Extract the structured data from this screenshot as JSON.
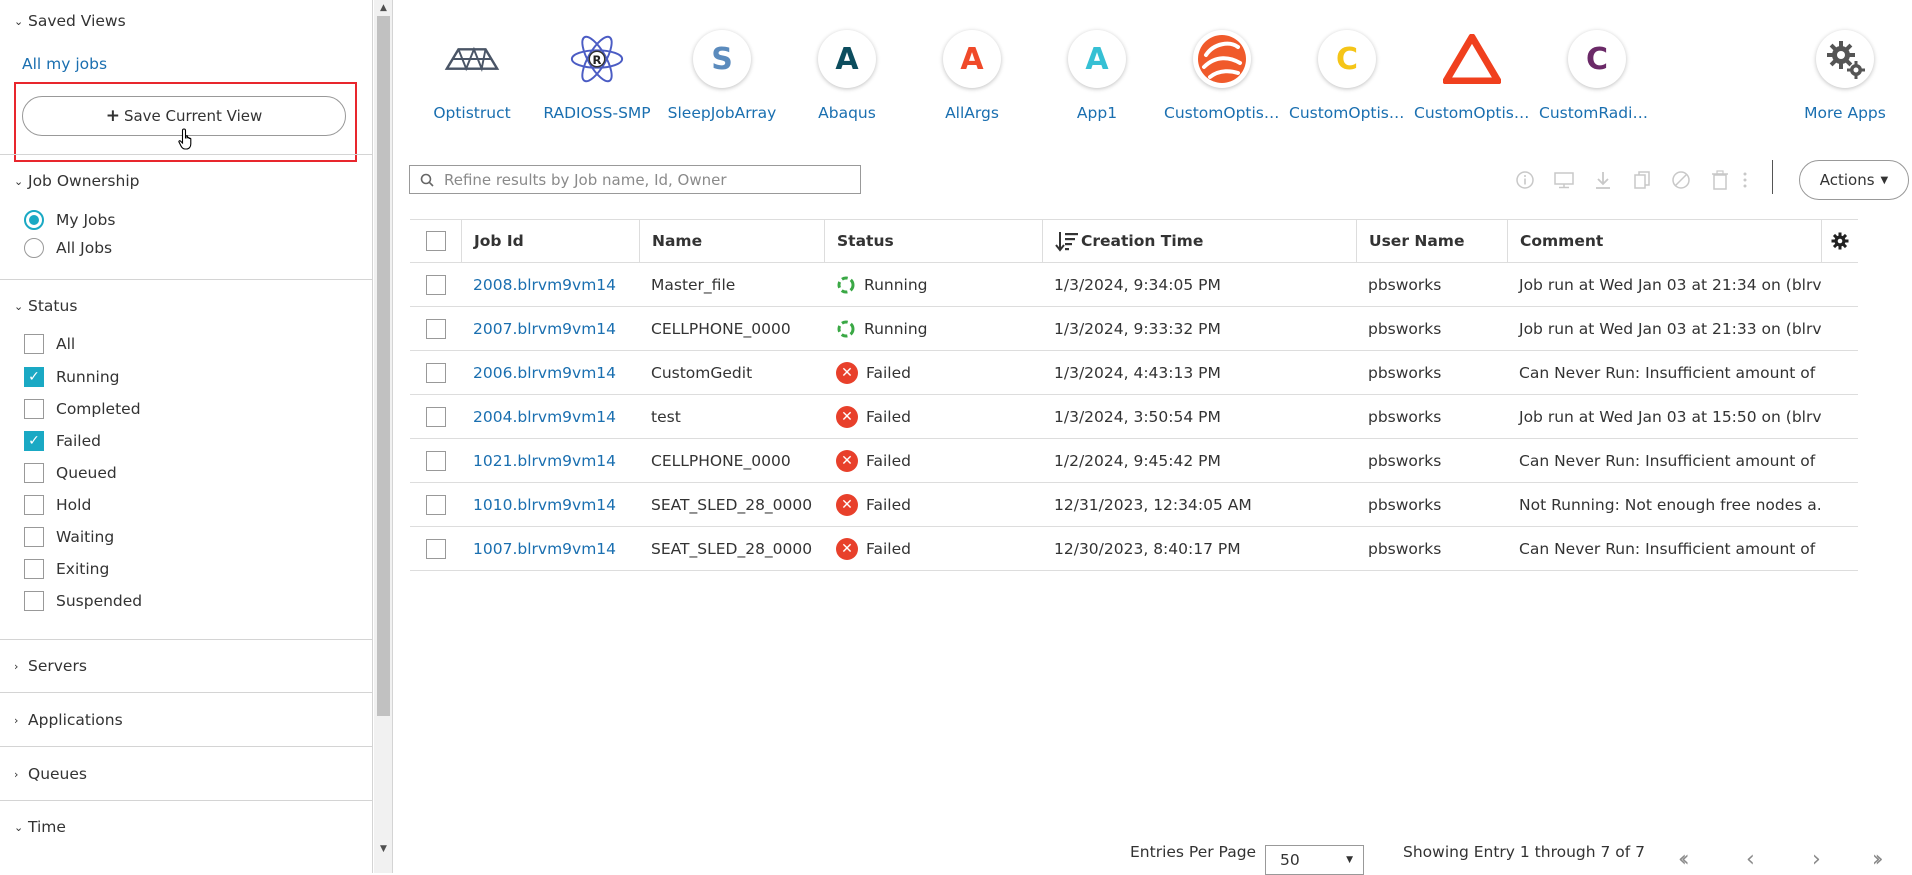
{
  "sidebar": {
    "saved_views": {
      "header": "Saved Views",
      "all_my_jobs": "All my jobs",
      "save_button": "Save Current View"
    },
    "ownership": {
      "header": "Job Ownership",
      "options": [
        {
          "label": "My Jobs",
          "selected": true
        },
        {
          "label": "All Jobs",
          "selected": false
        }
      ]
    },
    "status": {
      "header": "Status",
      "options": [
        {
          "label": "All",
          "checked": false
        },
        {
          "label": "Running",
          "checked": true
        },
        {
          "label": "Completed",
          "checked": false
        },
        {
          "label": "Failed",
          "checked": true
        },
        {
          "label": "Queued",
          "checked": false
        },
        {
          "label": "Hold",
          "checked": false
        },
        {
          "label": "Waiting",
          "checked": false
        },
        {
          "label": "Exiting",
          "checked": false
        },
        {
          "label": "Suspended",
          "checked": false
        }
      ]
    },
    "servers": "Servers",
    "applications": "Applications",
    "queues": "Queues",
    "time": "Time"
  },
  "apps": [
    {
      "label": "Optistruct",
      "icon": "optistruct-icon"
    },
    {
      "label": "RADIOSS-SMP",
      "icon": "radioss-atom-icon"
    },
    {
      "label": "SleepJobArray",
      "icon": "letter-s-icon",
      "letter": "S",
      "color": "#5b8bbd"
    },
    {
      "label": "Abaqus",
      "icon": "letter-a-icon",
      "letter": "A",
      "color": "#0c4d5e"
    },
    {
      "label": "AllArgs",
      "icon": "letter-a-icon",
      "letter": "A",
      "color": "#f04a2a"
    },
    {
      "label": "App1",
      "icon": "letter-a-icon",
      "letter": "A",
      "color": "#36c0d4"
    },
    {
      "label": "CustomOptist...",
      "icon": "custom-optistruct-swirl-icon"
    },
    {
      "label": "CustomOptist...",
      "icon": "letter-c-icon",
      "letter": "C",
      "color": "#f5c518"
    },
    {
      "label": "CustomOptist...",
      "icon": "altair-triangle-icon"
    },
    {
      "label": "CustomRadioss",
      "icon": "letter-c-icon",
      "letter": "C",
      "color": "#6b2a68"
    }
  ],
  "more_apps": "More Apps",
  "search": {
    "placeholder": "Refine results by Job name, Id, Owner",
    "value": ""
  },
  "actions_label": "Actions",
  "table": {
    "columns": [
      "Job Id",
      "Name",
      "Status",
      "Creation Time",
      "User Name",
      "Comment"
    ],
    "rows": [
      {
        "id": "2008.blrvm9vm14",
        "name": "Master_file",
        "status": "Running",
        "created": "1/3/2024, 9:34:05 PM",
        "user": "pbsworks",
        "comment": "Job run at Wed Jan 03 at 21:34 on (blrv..."
      },
      {
        "id": "2007.blrvm9vm14",
        "name": "CELLPHONE_0000",
        "status": "Running",
        "created": "1/3/2024, 9:33:32 PM",
        "user": "pbsworks",
        "comment": "Job run at Wed Jan 03 at 21:33 on (blrv..."
      },
      {
        "id": "2006.blrvm9vm14",
        "name": "CustomGedit",
        "status": "Failed",
        "created": "1/3/2024, 4:43:13 PM",
        "user": "pbsworks",
        "comment": "Can Never Run: Insufficient amount of ..."
      },
      {
        "id": "2004.blrvm9vm14",
        "name": "test",
        "status": "Failed",
        "created": "1/3/2024, 3:50:54 PM",
        "user": "pbsworks",
        "comment": "Job run at Wed Jan 03 at 15:50 on (blrv..."
      },
      {
        "id": "1021.blrvm9vm14",
        "name": "CELLPHONE_0000",
        "status": "Failed",
        "created": "1/2/2024, 9:45:42 PM",
        "user": "pbsworks",
        "comment": "Can Never Run: Insufficient amount of ..."
      },
      {
        "id": "1010.blrvm9vm14",
        "name": "SEAT_SLED_28_0000",
        "status": "Failed",
        "created": "12/31/2023, 12:34:05 AM",
        "user": "pbsworks",
        "comment": "Not Running: Not enough free nodes a..."
      },
      {
        "id": "1007.blrvm9vm14",
        "name": "SEAT_SLED_28_0000",
        "status": "Failed",
        "created": "12/30/2023, 8:40:17 PM",
        "user": "pbsworks",
        "comment": "Can Never Run: Insufficient amount of ..."
      }
    ]
  },
  "footer": {
    "entries_label": "Entries Per Page",
    "entries_value": "50",
    "showing": "Showing Entry 1 through 7 of 7"
  },
  "colors": {
    "accent": "#1aa9c4",
    "link": "#1a6fb0",
    "failed": "#e8402b",
    "running": "#3aa845",
    "highlight": "#e8262d"
  }
}
